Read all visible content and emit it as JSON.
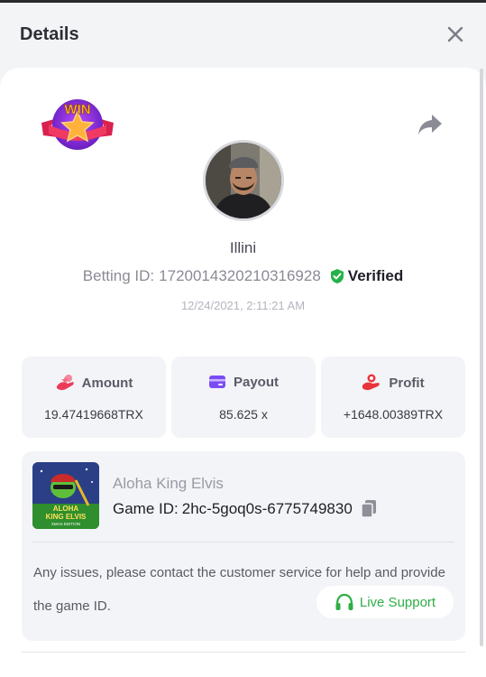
{
  "header": {
    "title": "Details",
    "close_icon": "close-icon"
  },
  "badge": {
    "text": "WIN",
    "icon": "win-star-ribbon-badge"
  },
  "share_icon": "share-arrow-icon",
  "user": {
    "name": "Illini",
    "betting_label": "Betting ID:",
    "betting_id": "1720014320210316928",
    "verified_label": "Verified",
    "timestamp": "12/24/2021, 2:11:21 AM"
  },
  "stats": [
    {
      "title": "Amount",
      "value": "19.47419668TRX",
      "icon": "coins-hand-icon",
      "icon_color": "#ec3a57"
    },
    {
      "title": "Payout",
      "value": "85.625 x",
      "icon": "card-icon",
      "icon_color": "#7b4cf5"
    },
    {
      "title": "Profit",
      "value": "+1648.00389TRX",
      "icon": "money-hand-icon",
      "icon_color": "#e8353a"
    }
  ],
  "game": {
    "name": "Aloha King Elvis",
    "thumb_title_line1": "ALOHA",
    "thumb_title_line2": "KING ELVIS",
    "thumb_subtitle": "XMAS EDITION",
    "id_label": "Game ID:",
    "id_value": "2hc-5goq0s-6775749830",
    "copy_icon": "copy-icon"
  },
  "support": {
    "message": "Any issues, please contact the customer service for help and provide the game ID.",
    "button_label": "Live Support",
    "button_icon": "headset-icon",
    "accent": "#2fae45"
  },
  "colors": {
    "verified": "#25b249",
    "background": "#f3f4f6"
  }
}
